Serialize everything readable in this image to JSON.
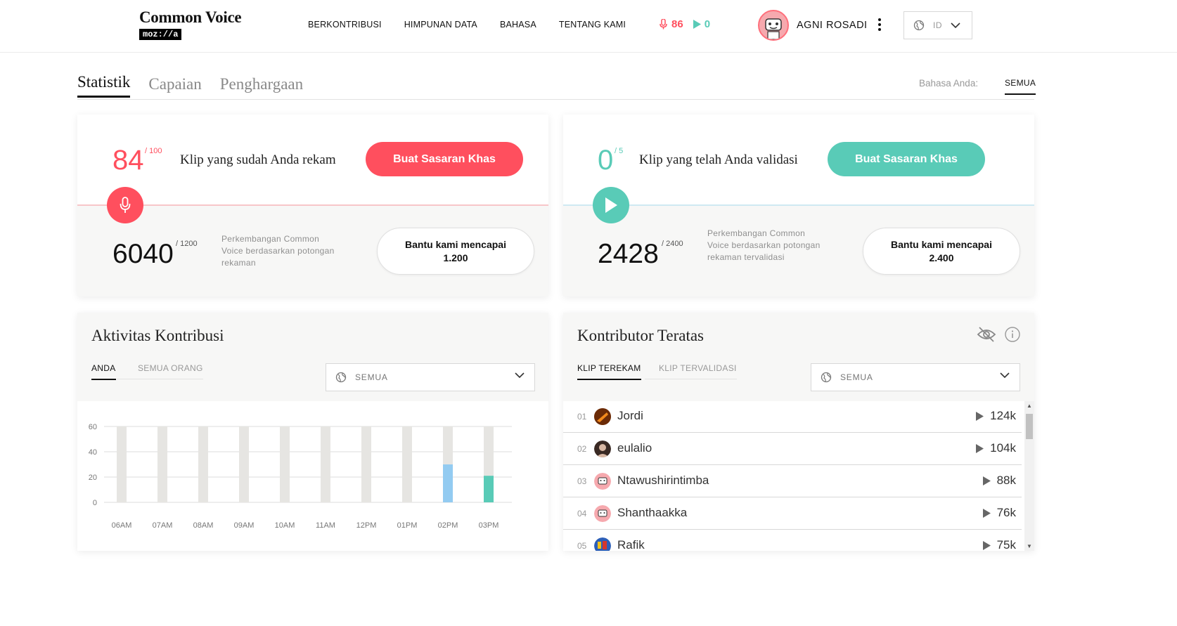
{
  "header": {
    "logo_title": "Common Voice",
    "logo_sub": "moz://a",
    "nav": [
      "BERKONTRIBUSI",
      "HIMPUNAN DATA",
      "BAHASA",
      "TENTANG KAMI"
    ],
    "recorded_count": "86",
    "validated_count": "0",
    "username": "AGNI ROSADI",
    "language_code": "ID"
  },
  "tabs": [
    "Statistik",
    "Capaian",
    "Penghargaan"
  ],
  "language_filter": {
    "label": "Bahasa Anda:",
    "value": "SEMUA"
  },
  "record_goal": {
    "value": "84",
    "max": "/ 100",
    "text": "Klip yang sudah Anda rekam",
    "button": "Buat Sasaran Khas",
    "progress_value": "6040",
    "progress_max": "/ 1200",
    "progress_text": "Perkembangan Common Voice berdasarkan potongan rekaman",
    "help_line1": "Bantu kami mencapai",
    "help_line2": "1.200"
  },
  "validate_goal": {
    "value": "0",
    "max": "/ 5",
    "text": "Klip yang telah Anda validasi",
    "button": "Buat Sasaran Khas",
    "progress_value": "2428",
    "progress_max": "/ 2400",
    "progress_text": "Perkembangan Common Voice berdasarkan potongan rekaman tervalidasi",
    "help_line1": "Bantu kami mencapai",
    "help_line2": "2.400"
  },
  "activity": {
    "title": "Aktivitas Kontribusi",
    "tab_you": "ANDA",
    "tab_all": "SEMUA ORANG",
    "dropdown": "SEMUA"
  },
  "leaderboard": {
    "title": "Kontributor Teratas",
    "tab_recorded": "KLIP TEREKAM",
    "tab_validated": "KLIP TERVALIDASI",
    "dropdown": "SEMUA",
    "rows": [
      {
        "rank": "01",
        "name": "Jordi",
        "count": "124k"
      },
      {
        "rank": "02",
        "name": "eulalio",
        "count": "104k"
      },
      {
        "rank": "03",
        "name": "Ntawushirintimba",
        "count": "88k"
      },
      {
        "rank": "04",
        "name": "Shanthaakka",
        "count": "76k"
      },
      {
        "rank": "05",
        "name": "Rafik",
        "count": "75k"
      }
    ]
  },
  "colors": {
    "record": "#ff4f5e",
    "validate": "#59cbb7",
    "bar_bg": "#e6e5e2",
    "bar_blue": "#93cbf1",
    "bar_teal": "#59cbb7"
  },
  "chart_data": {
    "type": "bar",
    "categories": [
      "06AM",
      "07AM",
      "08AM",
      "09AM",
      "10AM",
      "11AM",
      "12PM",
      "01PM",
      "02PM",
      "03PM"
    ],
    "series": [
      {
        "values": [
          0,
          0,
          0,
          0,
          0,
          0,
          0,
          0,
          30,
          21
        ]
      }
    ],
    "yticks": [
      0,
      20,
      40,
      60
    ],
    "ylim": [
      0,
      60
    ],
    "grid": true
  }
}
